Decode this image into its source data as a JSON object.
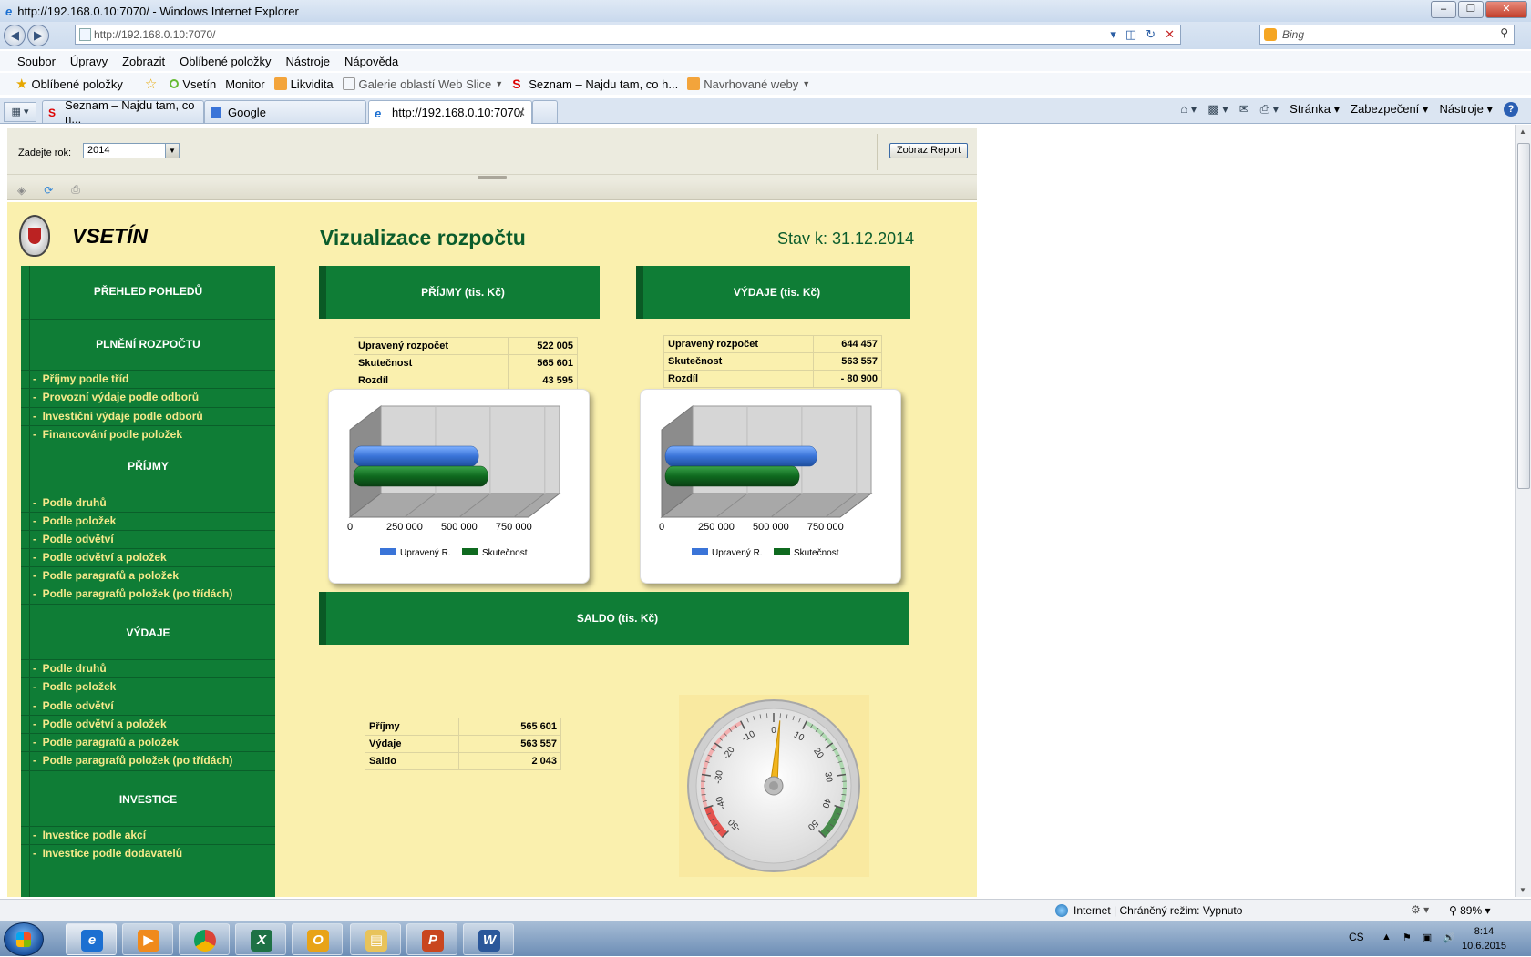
{
  "window": {
    "title": "http://192.168.0.10:7070/ - Windows Internet Explorer",
    "address": "http://192.168.0.10:7070/",
    "search_placeholder": "Bing"
  },
  "menu": [
    "Soubor",
    "Úpravy",
    "Zobrazit",
    "Oblíbené položky",
    "Nástroje",
    "Nápověda"
  ],
  "favorites": {
    "label": "Oblíbené položky",
    "items": [
      "Vsetín",
      "Monitor",
      "Likvidita",
      "Galerie oblastí Web Slice",
      "Seznam – Najdu tam, co h...",
      "Navrhované weby"
    ]
  },
  "tabs": [
    {
      "label": "Seznam – Najdu tam, co n..."
    },
    {
      "label": "Google"
    },
    {
      "label": "http://192.168.0.10:7070/"
    }
  ],
  "commandbar": {
    "page": "Stránka",
    "security": "Zabezpečení",
    "tools": "Nástroje"
  },
  "params": {
    "year_label": "Zadejte rok:",
    "year_value": "2014",
    "run_button": "Zobraz Report"
  },
  "report": {
    "city": "VSETÍN",
    "title": "Vizualizace rozpočtu",
    "stav": "Stav k: 31.12.2014",
    "sidebar": {
      "headings": [
        "PŘEHLED POHLEDŮ",
        "PLNĚNÍ ROZPOČTU",
        "PŘÍJMY",
        "VÝDAJE",
        "INVESTICE"
      ],
      "plneni_links": [
        "Příjmy podle tříd",
        "Provozní výdaje podle odborů",
        "Investiční výdaje podle odborů",
        "Financování podle položek"
      ],
      "prijmy_links": [
        "Podle druhů",
        "Podle položek",
        "Podle odvětví",
        "Podle odvětví a položek",
        "Podle paragrafů a položek",
        "Podle paragrafů  položek (po třídách)"
      ],
      "vydaje_links": [
        "Podle druhů",
        "Podle položek",
        "Podle odvětví",
        "Podle odvětví a položek",
        "Podle paragrafů a položek",
        "Podle paragrafů  položek (po třídách)"
      ],
      "investice_links": [
        "Investice podle akcí",
        "Investice podle dodavatelů"
      ]
    },
    "prijmy": {
      "header": "PŘÍJMY (tis. Kč)",
      "rows": [
        {
          "label": "Upravený rozpočet",
          "value": "522 005"
        },
        {
          "label": "Skutečnost",
          "value": "565 601"
        },
        {
          "label": "Rozdíl",
          "value": "43 595"
        }
      ]
    },
    "vydaje": {
      "header": "VÝDAJE (tis. Kč)",
      "rows": [
        {
          "label": "Upravený rozpočet",
          "value": "644 457"
        },
        {
          "label": "Skutečnost",
          "value": "563 557"
        },
        {
          "label": "Rozdíl",
          "value": "- 80 900"
        }
      ]
    },
    "saldo": {
      "header": "SALDO (tis. Kč)",
      "rows": [
        {
          "label": "Příjmy",
          "value": "565 601"
        },
        {
          "label": "Výdaje",
          "value": "563 557"
        },
        {
          "label": "Saldo",
          "value": "2 043"
        }
      ],
      "gauge": {
        "min": -50,
        "max": 50,
        "value": 2,
        "ticks": [
          "-50",
          "-40",
          "-30",
          "-20",
          "-10",
          "0",
          "10",
          "20",
          "30",
          "40",
          "50"
        ]
      }
    },
    "legend": [
      "Upravený R.",
      "Skutečnost"
    ]
  },
  "chart_data": [
    {
      "type": "bar",
      "orientation": "horizontal",
      "categories": [
        ""
      ],
      "series": [
        {
          "name": "Upravený R.",
          "values": [
            522005
          ],
          "color": "#3a74d8"
        },
        {
          "name": "Skutečnost",
          "values": [
            565601
          ],
          "color": "#0f6a1f"
        }
      ],
      "xlim": [
        0,
        1000000
      ],
      "tick_labels": [
        "0",
        "250 000",
        "500 000",
        "750 000"
      ],
      "legend": "bottom"
    },
    {
      "type": "bar",
      "orientation": "horizontal",
      "categories": [
        ""
      ],
      "series": [
        {
          "name": "Upravený R.",
          "values": [
            644457
          ],
          "color": "#3a74d8"
        },
        {
          "name": "Skutečnost",
          "values": [
            563557
          ],
          "color": "#0f6a1f"
        }
      ],
      "xlim": [
        0,
        1000000
      ],
      "tick_labels": [
        "0",
        "250 000",
        "500 000",
        "750 000"
      ],
      "legend": "bottom"
    }
  ],
  "statusbar": {
    "zone": "Internet | Chráněný režim: Vypnuto",
    "zoom": "89%"
  },
  "taskbar": {
    "lang": "CS",
    "time": "8:14",
    "date": "10.6.2015"
  },
  "colors": {
    "report_bg": "#faf0ae",
    "green": "#0f7d36",
    "link_yellow": "#f6e98a",
    "title_green": "#0b5c2c"
  }
}
